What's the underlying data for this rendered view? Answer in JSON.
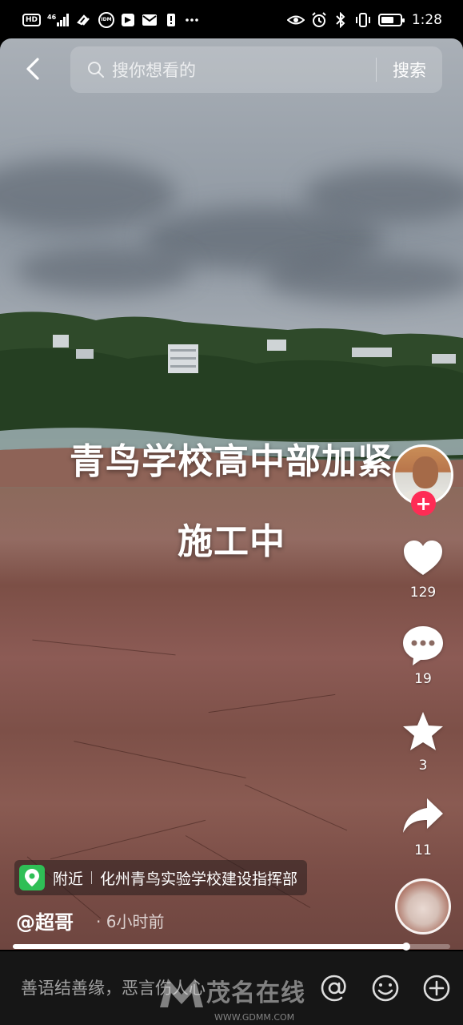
{
  "status_bar": {
    "hd": "HD",
    "signal": "46",
    "app_badge": "IDM",
    "time": "1:28",
    "battery_level": 0.7
  },
  "search": {
    "placeholder": "搜你想看的",
    "button_label": "搜索"
  },
  "video": {
    "caption_line1": "青鸟学校高中部加紧",
    "caption_line2": "施工中",
    "progress": 0.9
  },
  "actions": {
    "likes": "129",
    "comments": "19",
    "favorites": "3",
    "shares": "11",
    "follow_label": "+"
  },
  "location": {
    "label": "附近",
    "name": "化州青鸟实验学校建设指挥部"
  },
  "post": {
    "author": "@超哥",
    "time": "· 6小时前"
  },
  "comment_bar": {
    "placeholder": "善语结善缘，恶言伤人心"
  },
  "watermark": {
    "text": "茂名在线",
    "url": "WWW.GDMM.COM"
  },
  "colors": {
    "follow": "#fe2c55",
    "location_pin": "#2fbf56"
  }
}
